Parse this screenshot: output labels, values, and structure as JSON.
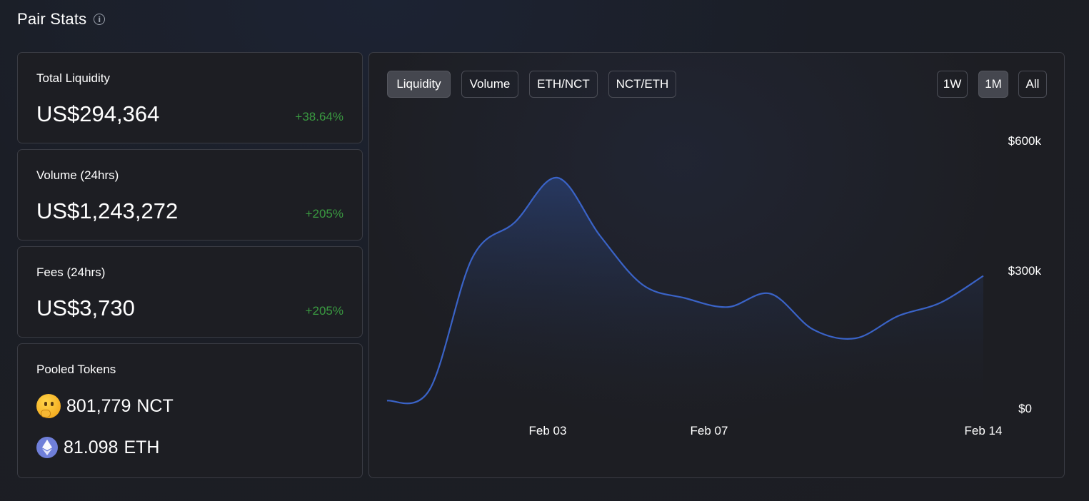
{
  "header": {
    "title": "Pair Stats",
    "info_icon": "info-icon"
  },
  "stats": [
    {
      "label": "Total Liquidity",
      "value": "US$294,364",
      "change": "+38.64%"
    },
    {
      "label": "Volume (24hrs)",
      "value": "US$1,243,272",
      "change": "+205%"
    },
    {
      "label": "Fees (24hrs)",
      "value": "US$3,730",
      "change": "+205%"
    }
  ],
  "pooled": {
    "label": "Pooled Tokens",
    "tokens": [
      {
        "amount": "801,779",
        "symbol": "NCT",
        "icon": "thinking-face-icon"
      },
      {
        "amount": "81.098",
        "symbol": "ETH",
        "icon": "ethereum-icon"
      }
    ]
  },
  "chart_controls": {
    "metric_tabs": [
      "Liquidity",
      "Volume",
      "ETH/NCT",
      "NCT/ETH"
    ],
    "active_metric": "Liquidity",
    "range_tabs": [
      "1W",
      "1M",
      "All"
    ],
    "active_range": "1M"
  },
  "colors": {
    "line": "#3a63c7",
    "positive": "#3a9a41",
    "panel": "#1d1e23",
    "border": "#3a3c44"
  },
  "chart_data": {
    "type": "area",
    "ylim": [
      0,
      600000
    ],
    "y_ticks": [
      "$0",
      "$300k",
      "$600k"
    ],
    "x_ticks": [
      "Feb 03",
      "Feb 07",
      "Feb 14"
    ],
    "series": [
      {
        "x": [
          "Jan 31",
          "Feb 01",
          "Feb 02",
          "Feb 03",
          "Feb 04",
          "Feb 05",
          "Feb 06",
          "Feb 07",
          "Feb 08",
          "Feb 09",
          "Feb 10",
          "Feb 11",
          "Feb 12",
          "Feb 13",
          "Feb 14"
        ],
        "values": [
          20000,
          45000,
          340000,
          420000,
          520000,
          390000,
          280000,
          250000,
          230000,
          260000,
          180000,
          160000,
          210000,
          240000,
          300000
        ]
      }
    ]
  }
}
